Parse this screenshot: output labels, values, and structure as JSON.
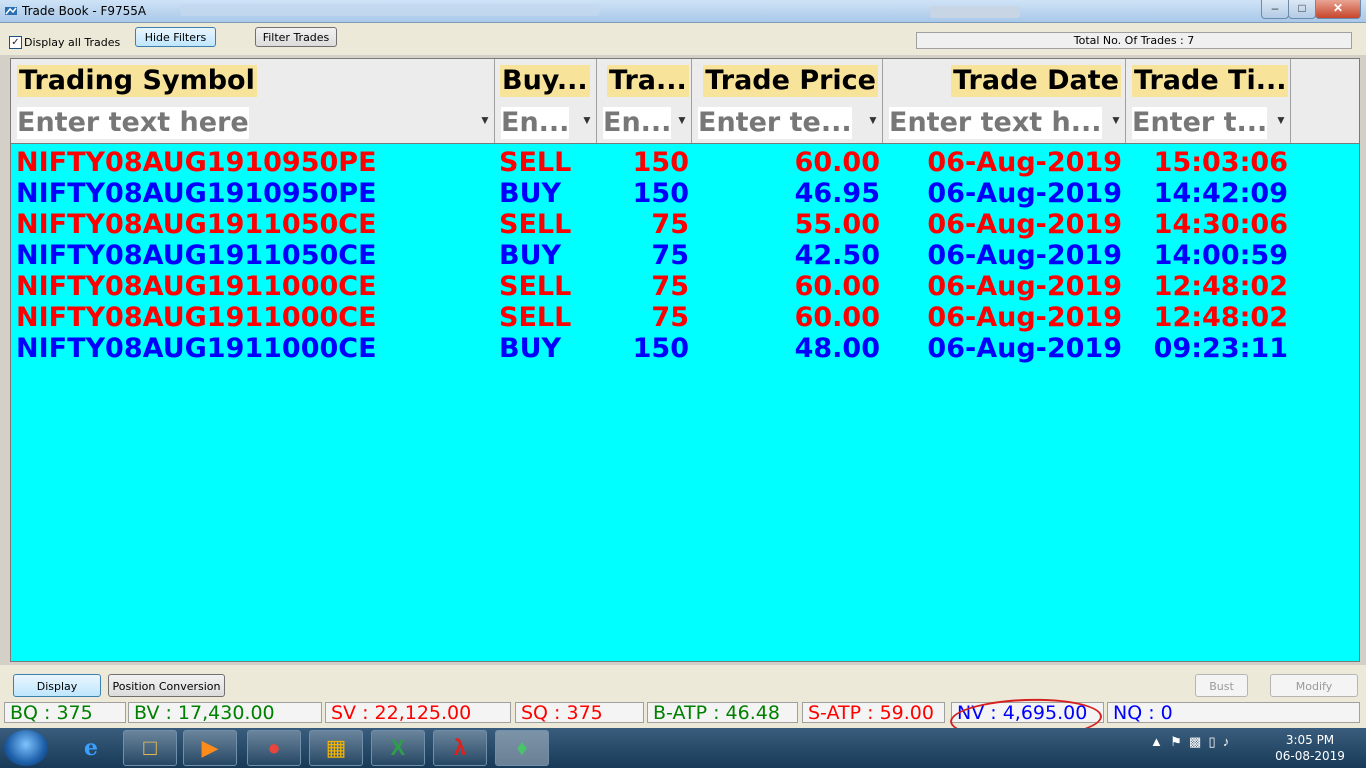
{
  "window": {
    "title": "Trade Book - F9755A"
  },
  "toolbar": {
    "display_all_label": "Display all Trades",
    "display_all_checked": true,
    "hide_filters_label": "Hide Filters",
    "filter_trades_label": "Filter Trades",
    "total_trades_text": "Total No. Of Trades : 7"
  },
  "grid": {
    "columns": [
      {
        "header": "Trading Symbol",
        "filter_placeholder": "Enter text here"
      },
      {
        "header": "Buy...",
        "filter_placeholder": "En..."
      },
      {
        "header": "Tra...",
        "filter_placeholder": "En..."
      },
      {
        "header": "Trade Price",
        "filter_placeholder": "Enter te..."
      },
      {
        "header": "Trade Date",
        "filter_placeholder": "Enter text h..."
      },
      {
        "header": "Trade Ti...",
        "filter_placeholder": "Enter t..."
      }
    ],
    "rows": [
      {
        "symbol": "NIFTY08AUG1910950PE",
        "side": "SELL",
        "qty": "150",
        "price": "60.00",
        "date": "06-Aug-2019",
        "time": "15:03:06",
        "color": "#ff0000"
      },
      {
        "symbol": "NIFTY08AUG1910950PE",
        "side": "BUY",
        "qty": "150",
        "price": "46.95",
        "date": "06-Aug-2019",
        "time": "14:42:09",
        "color": "#0000ff"
      },
      {
        "symbol": "NIFTY08AUG1911050CE",
        "side": "SELL",
        "qty": "75",
        "price": "55.00",
        "date": "06-Aug-2019",
        "time": "14:30:06",
        "color": "#ff0000"
      },
      {
        "symbol": "NIFTY08AUG1911050CE",
        "side": "BUY",
        "qty": "75",
        "price": "42.50",
        "date": "06-Aug-2019",
        "time": "14:00:59",
        "color": "#0000ff"
      },
      {
        "symbol": "NIFTY08AUG1911000CE",
        "side": "SELL",
        "qty": "75",
        "price": "60.00",
        "date": "06-Aug-2019",
        "time": "12:48:02",
        "color": "#ff0000"
      },
      {
        "symbol": "NIFTY08AUG1911000CE",
        "side": "SELL",
        "qty": "75",
        "price": "60.00",
        "date": "06-Aug-2019",
        "time": "12:48:02",
        "color": "#ff0000"
      },
      {
        "symbol": "NIFTY08AUG1911000CE",
        "side": "BUY",
        "qty": "150",
        "price": "48.00",
        "date": "06-Aug-2019",
        "time": "09:23:11",
        "color": "#0000ff"
      }
    ]
  },
  "actions": {
    "display_label": "Display",
    "position_conversion_label": "Position Conversion",
    "bust_label": "Bust",
    "modify_label": "Modify"
  },
  "status": [
    {
      "text": "BQ : 375",
      "color": "#008000"
    },
    {
      "text": "BV : 17,430.00",
      "color": "#008000"
    },
    {
      "text": "SV : 22,125.00",
      "color": "#ff0000"
    },
    {
      "text": "SQ : 375",
      "color": "#ff0000"
    },
    {
      "text": "B-ATP : 46.48",
      "color": "#008000"
    },
    {
      "text": "S-ATP : 59.00",
      "color": "#ff0000"
    },
    {
      "text": "NV : 4,695.00",
      "color": "#0000ff"
    },
    {
      "text": "NQ : 0",
      "color": "#0000ff"
    }
  ],
  "taskbar": {
    "clock_time": "3:05 PM",
    "clock_date": "06-08-2019"
  }
}
